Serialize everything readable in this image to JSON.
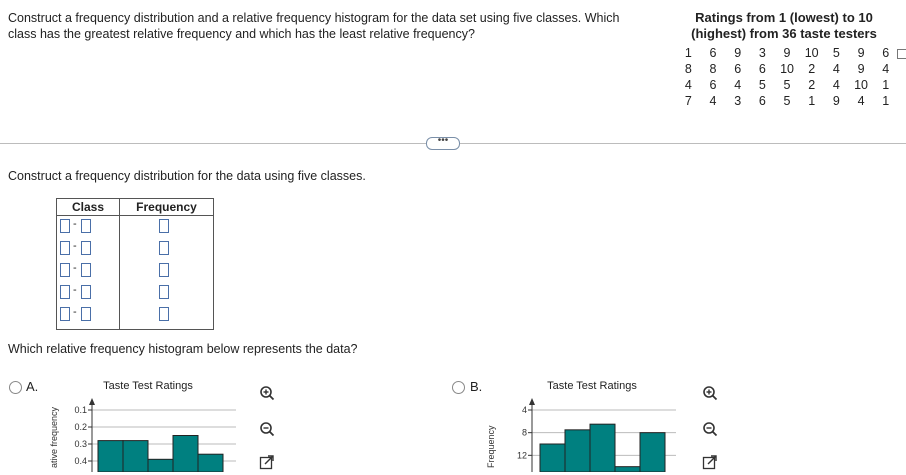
{
  "question": {
    "text_line1": "Construct a frequency distribution and a relative frequency histogram for the data set using five classes. Which",
    "text_line2": "class has the greatest relative frequency and which has the least relative frequency?"
  },
  "data_table": {
    "title_line1": "Ratings from 1 (lowest) to 10",
    "title_line2": "(highest) from 36 taste testers",
    "rows": [
      [
        "1",
        "6",
        "9",
        "3",
        "9",
        "10",
        "5",
        "9",
        "6"
      ],
      [
        "8",
        "8",
        "6",
        "6",
        "10",
        "2",
        "4",
        "9",
        "4"
      ],
      [
        "4",
        "6",
        "4",
        "5",
        "5",
        "2",
        "4",
        "10",
        "1"
      ],
      [
        "7",
        "4",
        "3",
        "6",
        "5",
        "1",
        "9",
        "4",
        "1"
      ]
    ]
  },
  "more_button": {
    "label": "•••"
  },
  "part1": {
    "prompt": "Construct a frequency distribution for the data using five classes.",
    "class_header": "Class",
    "frequency_header": "Frequency",
    "dash": "-"
  },
  "part2": {
    "prompt": "Which relative frequency histogram below represents the data?"
  },
  "options": {
    "a": {
      "label": "A.",
      "chart_title": "Taste Test Ratings",
      "ylabel": "ative frequency",
      "yticks": [
        "0.4",
        "0.3",
        "0.2",
        "0.1"
      ]
    },
    "b": {
      "label": "B.",
      "chart_title": "Taste Test Ratings",
      "ylabel": "Frequency",
      "yticks": [
        "12",
        "8",
        "4"
      ]
    }
  },
  "chart_data": [
    {
      "type": "bar",
      "title": "Taste Test Ratings",
      "ylabel": "ative frequency",
      "ylim": [
        0,
        0.4
      ],
      "yticks": [
        0.1,
        0.2,
        0.3,
        0.4
      ],
      "values": [
        0.22,
        0.22,
        0.11,
        0.25,
        0.14
      ],
      "color": "#008080"
    },
    {
      "type": "bar",
      "title": "Taste Test Ratings",
      "ylabel": "Frequency",
      "ylim": [
        0,
        12
      ],
      "yticks": [
        4,
        8,
        12
      ],
      "values": [
        6,
        8.5,
        9.5,
        2,
        8
      ],
      "color": "#008080"
    }
  ],
  "colors": {
    "bar": "#008080",
    "input_border": "#4a6fa8",
    "divider": "#bcbcbc"
  }
}
